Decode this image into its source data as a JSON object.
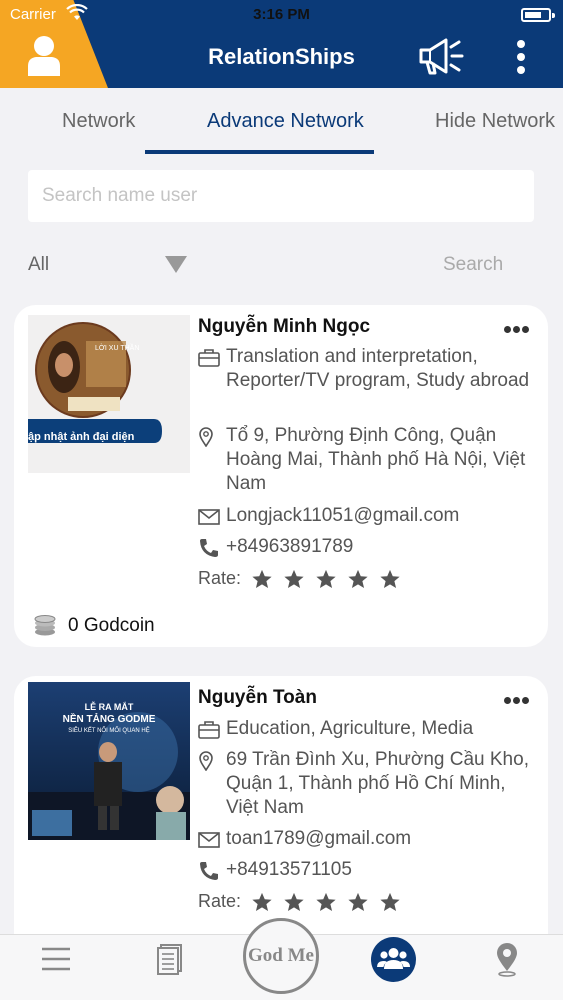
{
  "status": {
    "carrier": "Carrier",
    "time": "3:16 PM"
  },
  "header": {
    "title": "RelationShips"
  },
  "tabs": [
    {
      "label": "Network"
    },
    {
      "label": "Advance Network"
    },
    {
      "label": "Hide Network"
    }
  ],
  "search": {
    "placeholder": "Search name user"
  },
  "filter": {
    "selected": "All",
    "search_label": "Search"
  },
  "cards": [
    {
      "name": "Nguyễn Minh Ngọc",
      "photo_banner": "ập nhật ảnh đại diện",
      "photo_text": "LỜI XU THẦN",
      "job": "Translation and interpretation, Reporter/TV program, Study abroad",
      "address": "Tổ 9, Phường Định Công, Quận Hoàng Mai, Thành phố Hà Nội, Việt Nam",
      "email": "Longjack11051@gmail.com",
      "phone": "+84963891789",
      "rate_label": "Rate:",
      "rating": 0,
      "godcoin": "0 Godcoin"
    },
    {
      "name": "Nguyễn Toàn",
      "photo_lines": [
        "LỄ RA MẮT",
        "NỀN TẢNG GODME",
        "SIÊU KẾT NỐI MỐI QUAN HỆ"
      ],
      "job": "Education, Agriculture, Media",
      "address": "69 Trần Đình Xu, Phường Cầu Kho, Quận 1, Thành phố Hồ Chí Minh, Việt Nam",
      "email": "toan1789@gmail.com",
      "phone": "+84913571105",
      "rate_label": "Rate:",
      "rating": 0
    }
  ],
  "tabbar": {
    "center_logo": "God Me"
  },
  "colors": {
    "primary": "#0b3a78",
    "accent": "#f5a623",
    "star": "#555555"
  }
}
